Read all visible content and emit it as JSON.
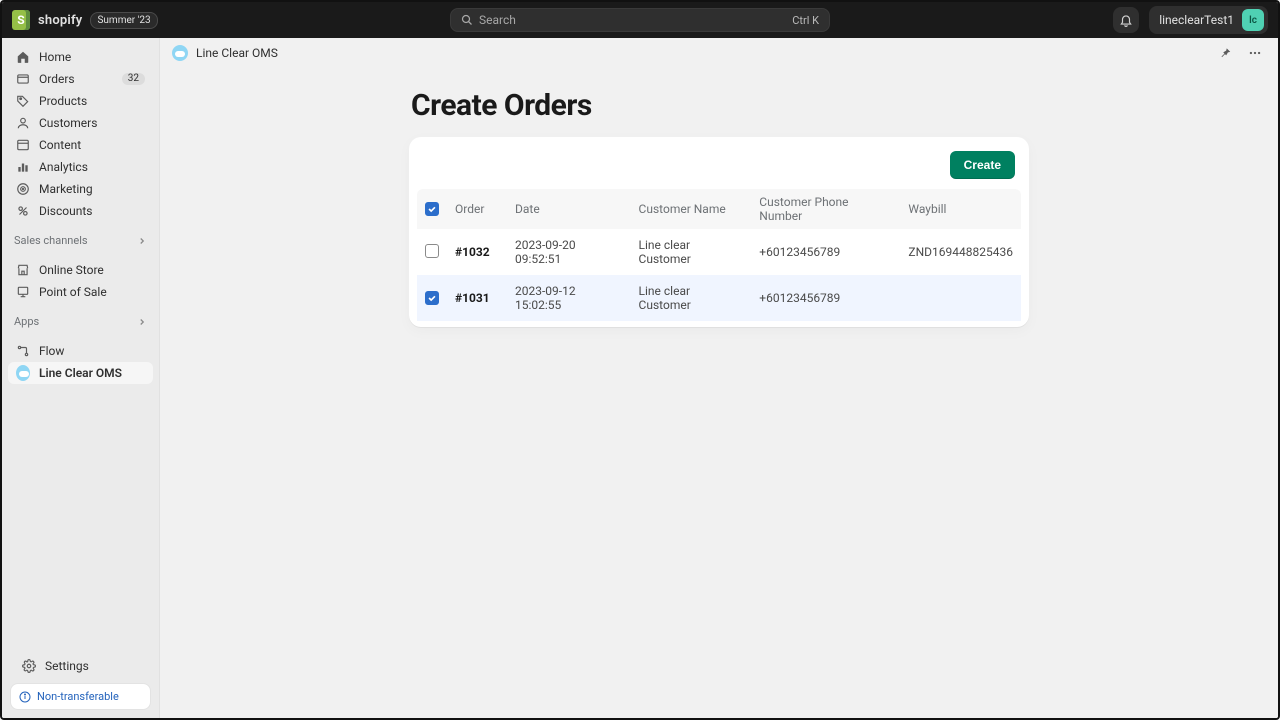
{
  "topbar": {
    "brand": "shopify",
    "edition_badge": "Summer '23",
    "search_placeholder": "Search",
    "search_shortcut": "Ctrl K",
    "username": "lineclearTest1",
    "avatar_initials": "lc"
  },
  "sidebar": {
    "nav": [
      {
        "label": "Home",
        "icon": "home-icon"
      },
      {
        "label": "Orders",
        "icon": "orders-icon",
        "count": "32"
      },
      {
        "label": "Products",
        "icon": "products-icon"
      },
      {
        "label": "Customers",
        "icon": "customers-icon"
      },
      {
        "label": "Content",
        "icon": "content-icon"
      },
      {
        "label": "Analytics",
        "icon": "analytics-icon"
      },
      {
        "label": "Marketing",
        "icon": "marketing-icon"
      },
      {
        "label": "Discounts",
        "icon": "discounts-icon"
      }
    ],
    "section_channels_label": "Sales channels",
    "channels": [
      {
        "label": "Online Store",
        "icon": "store-icon"
      },
      {
        "label": "Point of Sale",
        "icon": "pos-icon"
      }
    ],
    "section_apps_label": "Apps",
    "apps": [
      {
        "label": "Flow",
        "icon": "flow-icon"
      },
      {
        "label": "Line Clear OMS",
        "icon": "cloud-icon",
        "selected": true
      }
    ],
    "settings_label": "Settings",
    "info_pill": "Non-transferable"
  },
  "subheader": {
    "app_name": "Line Clear OMS"
  },
  "page": {
    "title": "Create Orders",
    "create_button": "Create"
  },
  "table": {
    "columns": {
      "order": "Order",
      "date": "Date",
      "customer_name": "Customer Name",
      "customer_phone": "Customer Phone Number",
      "waybill": "Waybill"
    },
    "rows": [
      {
        "checked": false,
        "order": "#1032",
        "date": "2023-09-20 09:52:51",
        "customer_name": "Line clear Customer",
        "customer_phone": "+60123456789",
        "waybill": "ZND169448825436"
      },
      {
        "checked": true,
        "order": "#1031",
        "date": "2023-09-12 15:02:55",
        "customer_name": "Line clear Customer",
        "customer_phone": "+60123456789",
        "waybill": ""
      }
    ],
    "header_checked": true
  }
}
